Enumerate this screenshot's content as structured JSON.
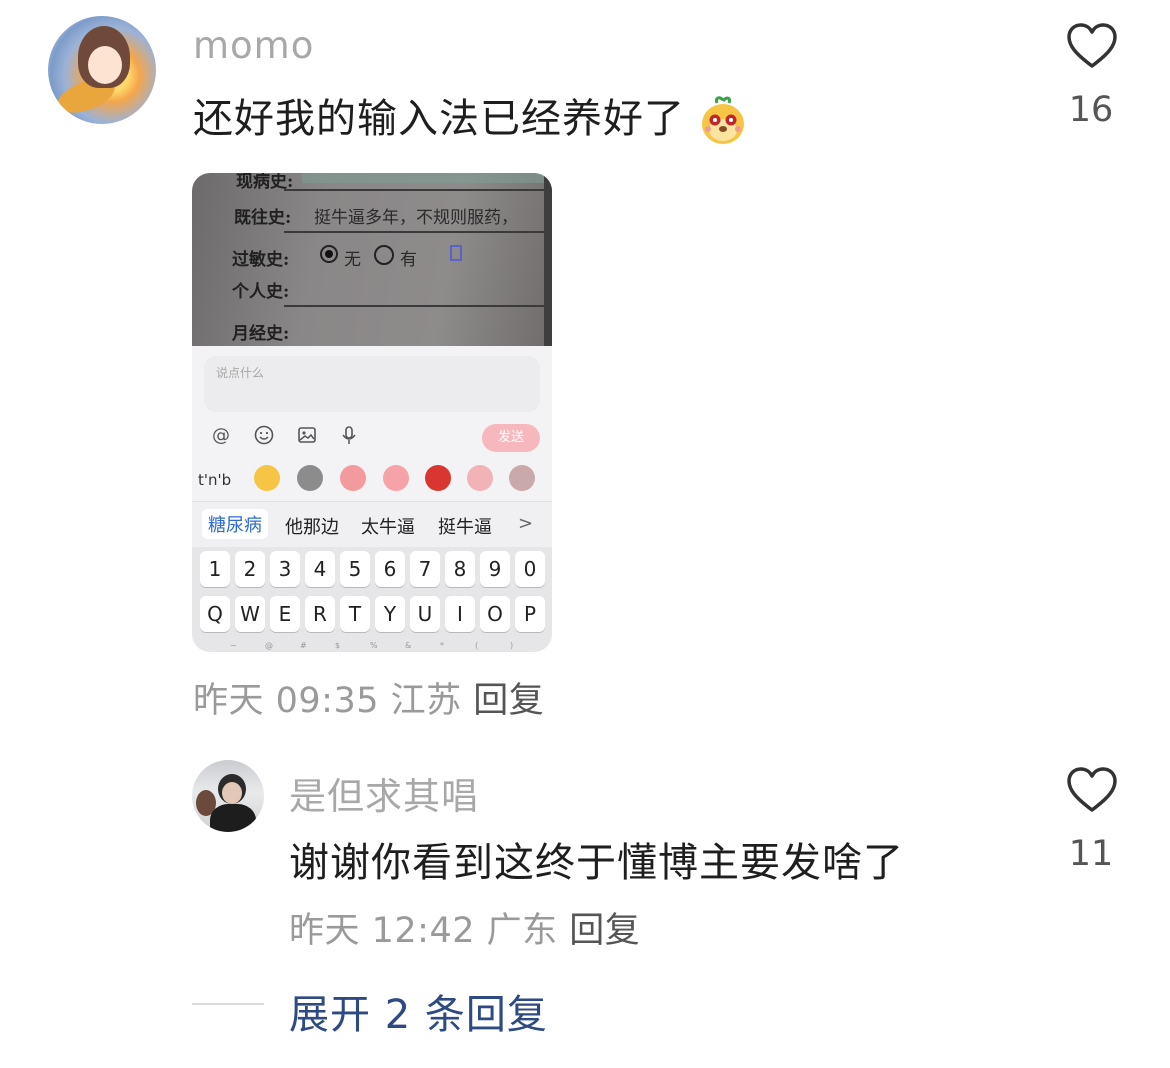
{
  "comment": {
    "username": "momo",
    "text": "还好我的输入法已经养好了",
    "emoji_icon": "sticker-face-icon",
    "likes": "16",
    "time": "昨天 09:35",
    "location": "江苏",
    "reply_label": "回复",
    "image": {
      "paper_lines": {
        "top": "现病史:",
        "history_label": "既往史:",
        "history_text": "挺牛逼多年，不规则服药，",
        "allergy_label": "过敏史:",
        "allergy_none": "无",
        "allergy_yes": "有",
        "personal_label": "个人史:",
        "menstrual_label": "月经史:"
      },
      "input_placeholder": "说点什么",
      "send_label": "发送",
      "pinyin": "t'n'b",
      "candidates": [
        "糖尿病",
        "他那边",
        "太牛逼",
        "挺牛逼"
      ],
      "more_arrow": ">",
      "number_keys": [
        "1",
        "2",
        "3",
        "4",
        "5",
        "6",
        "7",
        "8",
        "9",
        "0"
      ],
      "letter_keys": [
        "Q",
        "W",
        "E",
        "R",
        "T",
        "Y",
        "U",
        "I",
        "O",
        "P"
      ],
      "sub_symbols": [
        "~",
        "@",
        "#",
        "$",
        "%",
        "&",
        "*",
        "(",
        ")"
      ]
    }
  },
  "reply": {
    "username": "是但求其唱",
    "text": "谢谢你看到这终于懂博主要发啥了",
    "likes": "11",
    "time": "昨天 12:42",
    "location": "广东",
    "reply_label": "回复"
  },
  "expand": {
    "label": "展开 2 条回复"
  },
  "colors": {
    "username": "#a8a8a8",
    "meta": "#9a9a9a",
    "expand_link": "#2e4a82",
    "send_button": "#f7b8bd",
    "candidate_selected": "#2f6bcf"
  }
}
